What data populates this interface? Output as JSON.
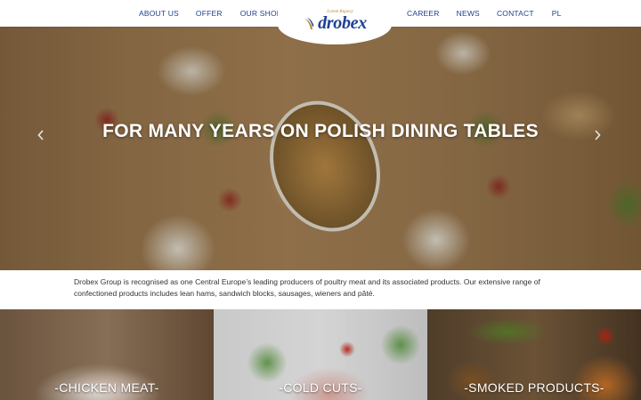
{
  "nav": {
    "left": [
      "ABOUT US",
      "OFFER",
      "OUR SHOPS"
    ],
    "right": [
      "CAREER",
      "NEWS",
      "CONTACT",
      "PL"
    ]
  },
  "logo": {
    "tagline": "Lorem Kujawy",
    "name": "drobex",
    "brand_color": "#1e3f95",
    "accent_color": "#b38a2a"
  },
  "hero": {
    "title": "FOR MANY YEARS ON POLISH DINING TABLES",
    "prev_icon": "chevron-left-icon",
    "next_icon": "chevron-right-icon"
  },
  "intro": {
    "text": "Drobex Group is recognised as one Central Europe’s leading producers of poultry meat and its associated products. Our extensive range of confectioned products includes lean hams, sandwich blocks, sausages, wieners and pâté."
  },
  "categories": [
    {
      "label": "-CHICKEN MEAT-"
    },
    {
      "label": "-COLD CUTS-"
    },
    {
      "label": "-SMOKED PRODUCTS-"
    }
  ]
}
